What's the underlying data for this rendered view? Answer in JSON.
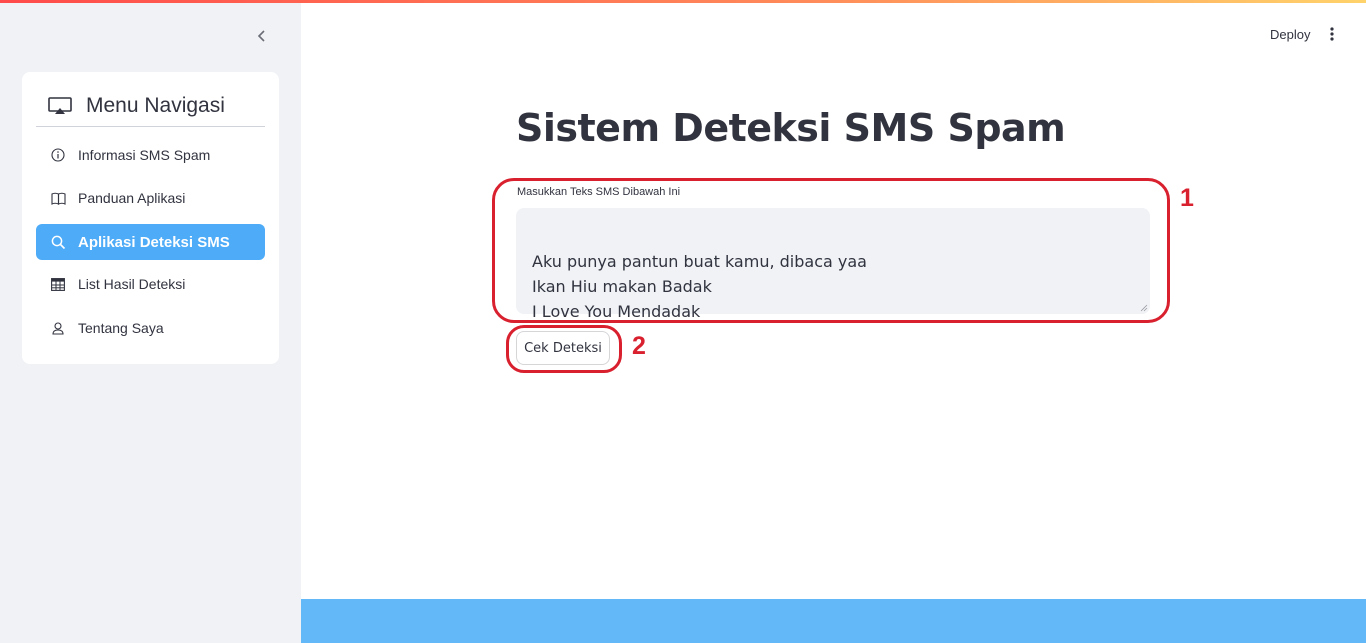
{
  "sidebar": {
    "collapse_icon": "chevron-left-icon",
    "menu": {
      "title": "Menu Navigasi",
      "title_icon": "airplay-icon",
      "items": [
        {
          "label": "Informasi SMS Spam",
          "icon": "info-circle-icon",
          "active": false
        },
        {
          "label": "Panduan Aplikasi",
          "icon": "book-icon",
          "active": false
        },
        {
          "label": "Aplikasi Deteksi SMS",
          "icon": "search-icon",
          "active": true
        },
        {
          "label": "List Hasil Deteksi",
          "icon": "table-icon",
          "active": false
        },
        {
          "label": "Tentang Saya",
          "icon": "person-icon",
          "active": false
        }
      ]
    }
  },
  "header": {
    "deploy_label": "Deploy",
    "menu_icon": "kebab-menu-icon"
  },
  "main": {
    "title": "Sistem Deteksi SMS Spam",
    "input_label": "Masukkan Teks SMS Dibawah Ini",
    "input_value": "Aku punya pantun buat kamu, dibaca yaa\nIkan Hiu makan Badak\nI Love You Mendadak",
    "submit_label": "Cek Deteksi"
  },
  "annotations": {
    "marker_1": "1",
    "marker_2": "2"
  },
  "colors": {
    "accent_active": "#4dabf7",
    "sidebar_bg": "#f0f2f6",
    "annotation": "#d9202e",
    "footer": "#63b8f8"
  }
}
